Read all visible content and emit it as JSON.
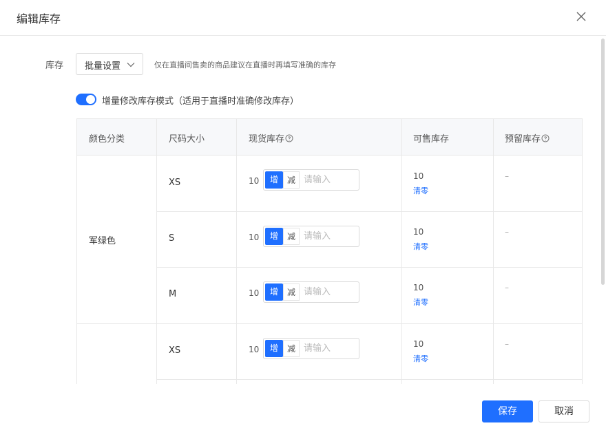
{
  "dialog": {
    "title": "编辑库存"
  },
  "stock_setting": {
    "label": "库存",
    "batch_select": "批量设置",
    "hint": "仅在直播间售卖的商品建议在直播时再填写准确的库存"
  },
  "mode": {
    "enabled": true,
    "label": "增量修改库存模式（适用于直播时准确修改库存）"
  },
  "table": {
    "headers": [
      "颜色分类",
      "尺码大小",
      "现货库存",
      "可售库存",
      "预留库存"
    ],
    "groups": [
      {
        "color": "军绿色"
      },
      {
        "color": ""
      }
    ],
    "rows": [
      {
        "size": "XS",
        "stock": "10",
        "inc": "增",
        "dec": "减",
        "placeholder": "请输入",
        "available": "10",
        "clear": "清零",
        "reserved": "–"
      },
      {
        "size": "S",
        "stock": "10",
        "inc": "增",
        "dec": "减",
        "placeholder": "请输入",
        "available": "10",
        "clear": "清零",
        "reserved": "–"
      },
      {
        "size": "M",
        "stock": "10",
        "inc": "增",
        "dec": "减",
        "placeholder": "请输入",
        "available": "10",
        "clear": "清零",
        "reserved": "–"
      },
      {
        "size": "XS",
        "stock": "10",
        "inc": "增",
        "dec": "减",
        "placeholder": "请输入",
        "available": "10",
        "clear": "清零",
        "reserved": "–"
      }
    ]
  },
  "footer": {
    "save": "保存",
    "cancel": "取消"
  },
  "icons": {
    "close": "close-icon",
    "chevron": "chevron-down-icon",
    "help": "help-circle-icon"
  },
  "colors": {
    "primary": "#1f6fff"
  }
}
